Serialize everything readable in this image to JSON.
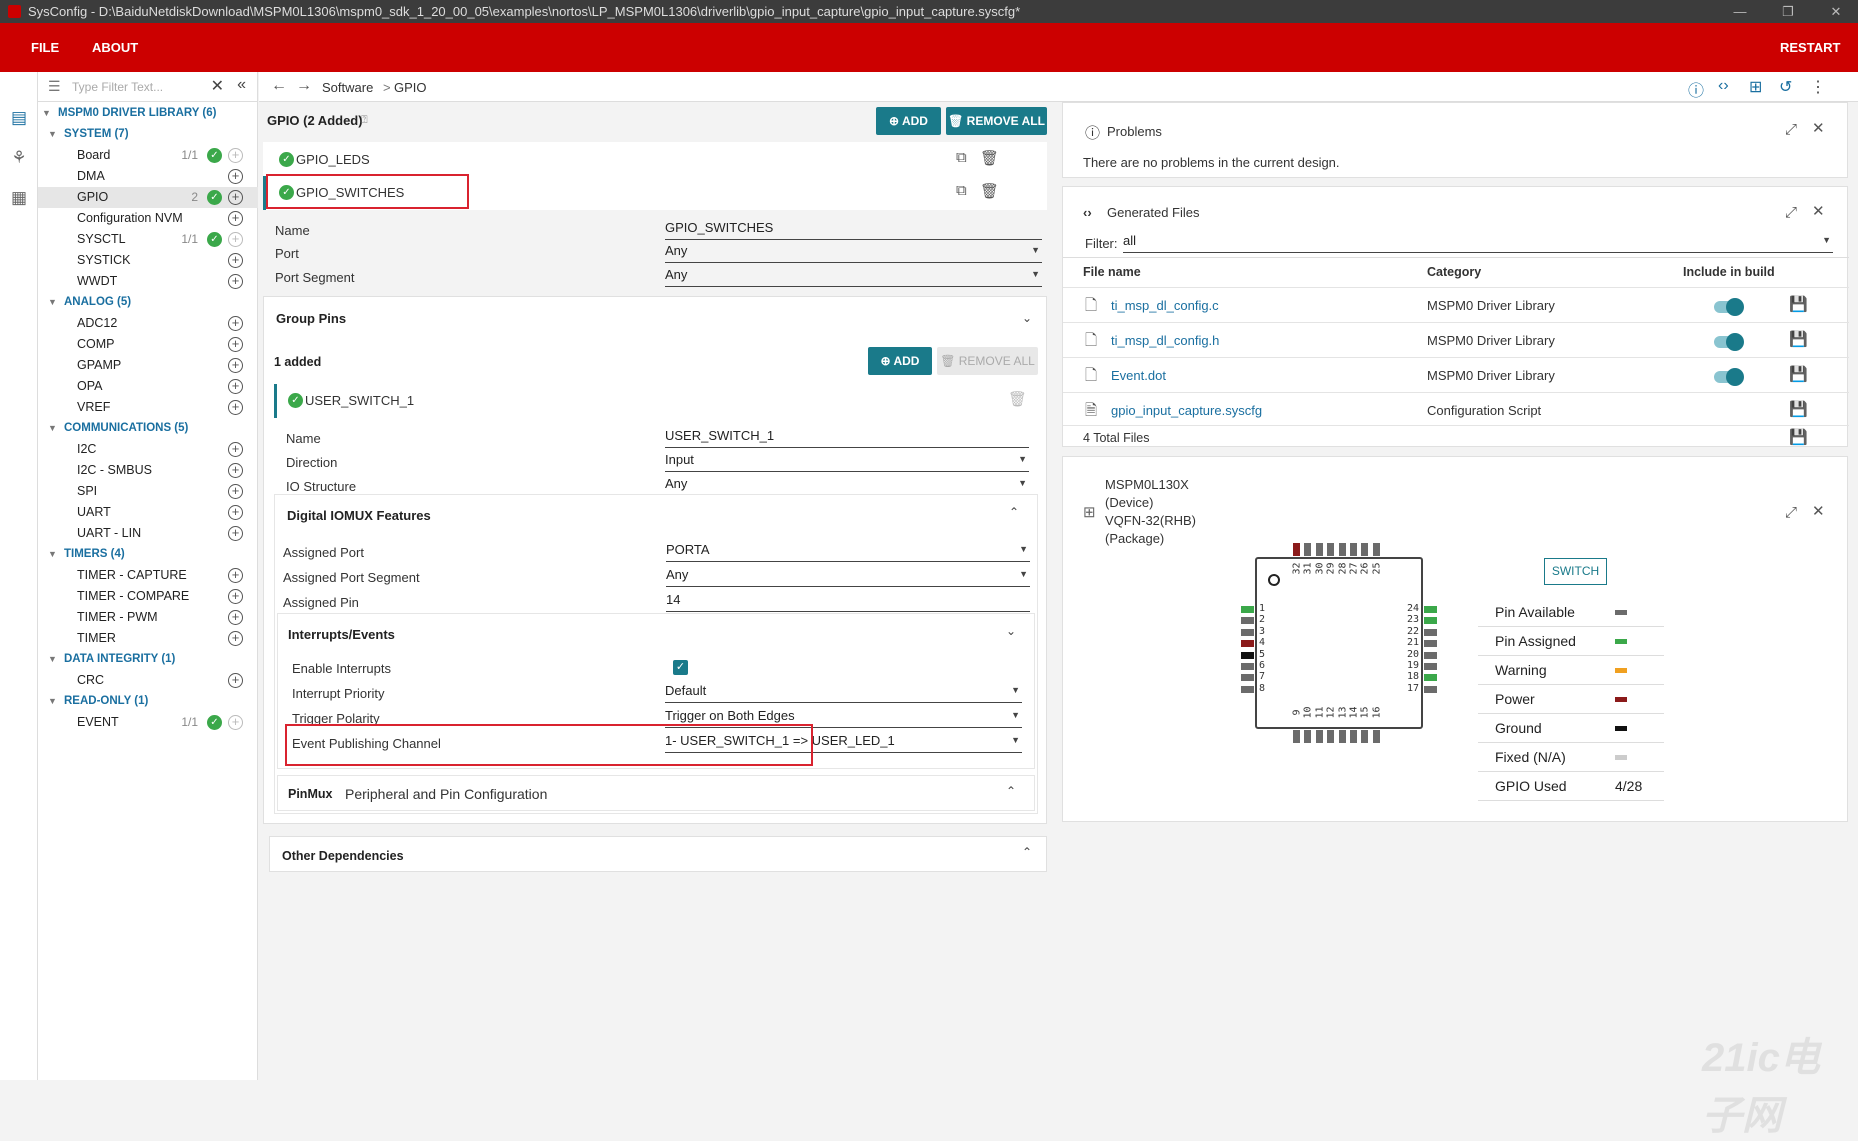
{
  "window": {
    "title": "SysConfig - D:\\BaiduNetdiskDownload\\MSPM0L1306\\mspm0_sdk_1_20_00_05\\examples\\nortos\\LP_MSPM0L1306\\driverlib\\gpio_input_capture\\gpio_input_capture.syscfg*",
    "minimize": "—",
    "maximize": "❐",
    "close": "✕"
  },
  "menu": {
    "file": "FILE",
    "about": "ABOUT",
    "restart": "RESTART"
  },
  "filter": {
    "placeholder": "Type Filter Text..."
  },
  "tree": {
    "library": {
      "label": "MSPM0 DRIVER LIBRARY (6)"
    },
    "system": {
      "label": "SYSTEM (7)",
      "items": [
        {
          "label": "Board",
          "count": "1/1"
        },
        {
          "label": "DMA",
          "count": ""
        },
        {
          "label": "GPIO",
          "count": "2"
        },
        {
          "label": "Configuration NVM",
          "count": ""
        },
        {
          "label": "SYSCTL",
          "count": "1/1"
        },
        {
          "label": "SYSTICK",
          "count": ""
        },
        {
          "label": "WWDT",
          "count": ""
        }
      ]
    },
    "analog": {
      "label": "ANALOG (5)",
      "items": [
        "ADC12",
        "COMP",
        "GPAMP",
        "OPA",
        "VREF"
      ]
    },
    "communications": {
      "label": "COMMUNICATIONS (5)",
      "items": [
        "I2C",
        "I2C - SMBUS",
        "SPI",
        "UART",
        "UART - LIN"
      ]
    },
    "timers": {
      "label": "TIMERS (4)",
      "items": [
        "TIMER - CAPTURE",
        "TIMER - COMPARE",
        "TIMER - PWM",
        "TIMER"
      ]
    },
    "integrity": {
      "label": "DATA INTEGRITY (1)",
      "items": [
        "CRC"
      ]
    },
    "readonly": {
      "label": "READ-ONLY (1)",
      "items": [
        {
          "label": "EVENT",
          "count": "1/1"
        }
      ]
    }
  },
  "breadcrumb": {
    "software": "Software",
    "sep": ">",
    "gpio": "GPIO"
  },
  "gpio": {
    "header": "GPIO (2 Added)",
    "add": "ADD",
    "remove_all": "REMOVE ALL",
    "instances": [
      "GPIO_LEDS",
      "GPIO_SWITCHES"
    ],
    "name_label": "Name",
    "name_value": "GPIO_SWITCHES",
    "port_label": "Port",
    "port_value": "Any",
    "segment_label": "Port Segment",
    "segment_value": "Any",
    "group_pins": "Group Pins",
    "added": "1 added",
    "pin_add": "ADD",
    "pin_remove_all": "REMOVE ALL",
    "pin_instance": "USER_SWITCH_1",
    "pin": {
      "name_label": "Name",
      "name_value": "USER_SWITCH_1",
      "direction_label": "Direction",
      "direction_value": "Input",
      "io_label": "IO Structure",
      "io_value": "Any"
    },
    "iomux": {
      "title": "Digital IOMUX Features",
      "port_label": "Assigned Port",
      "port_value": "PORTA",
      "segment_label": "Assigned Port Segment",
      "segment_value": "Any",
      "pin_label": "Assigned Pin",
      "pin_value": "14"
    },
    "interrupts": {
      "title": "Interrupts/Events",
      "enable_label": "Enable Interrupts",
      "priority_label": "Interrupt Priority",
      "priority_value": "Default",
      "trigger_label": "Trigger Polarity",
      "trigger_value": "Trigger on Both Edges",
      "channel_label": "Event Publishing Channel",
      "channel_value": "1- USER_SWITCH_1 =>  USER_LED_1"
    },
    "pinmux": {
      "tag": "PinMux",
      "title": "Peripheral and Pin Configuration"
    },
    "other_deps": "Other Dependencies"
  },
  "problems": {
    "title": "Problems",
    "message": "There are no problems in the current design."
  },
  "generated": {
    "title": "Generated Files",
    "filter_label": "Filter:",
    "filter_value": "all",
    "col_file": "File name",
    "col_category": "Category",
    "col_include": "Include in build",
    "files": [
      {
        "name": "ti_msp_dl_config.c",
        "category": "MSPM0 Driver Library"
      },
      {
        "name": "ti_msp_dl_config.h",
        "category": "MSPM0 Driver Library"
      },
      {
        "name": "Event.dot",
        "category": "MSPM0 Driver Library"
      },
      {
        "name": "gpio_input_capture.syscfg",
        "category": "Configuration Script"
      }
    ],
    "total": "4 Total Files"
  },
  "device": {
    "line1": "MSPM0L130X",
    "line2": "(Device)",
    "line3": "VQFN-32(RHB)",
    "line4": "(Package)",
    "switch": "SWITCH",
    "legend": [
      {
        "label": "Pin Available",
        "color": "#6b6b6b"
      },
      {
        "label": "Pin Assigned",
        "color": "#3ba84a"
      },
      {
        "label": "Warning",
        "color": "#f0a020"
      },
      {
        "label": "Power",
        "color": "#8b1a1a"
      },
      {
        "label": "Ground",
        "color": "#111111"
      },
      {
        "label": "Fixed (N/A)",
        "color": "#cccccc"
      }
    ],
    "gpio_used_label": "GPIO Used",
    "gpio_used_value": "4/28",
    "pins_left": [
      "1",
      "2",
      "3",
      "4",
      "5",
      "6",
      "7",
      "8"
    ],
    "pins_bottom": [
      "9",
      "10",
      "11",
      "12",
      "13",
      "14",
      "15",
      "16"
    ],
    "pins_right": [
      "24",
      "23",
      "22",
      "21",
      "20",
      "19",
      "18",
      "17"
    ],
    "pins_top": [
      "32",
      "31",
      "30",
      "29",
      "28",
      "27",
      "26",
      "25"
    ]
  },
  "colors": {
    "brand": "#cc0000",
    "accent": "#1a7a8a",
    "link": "#1a6fa0",
    "highlight": "#d9232f"
  },
  "watermark": "21ic电子网"
}
